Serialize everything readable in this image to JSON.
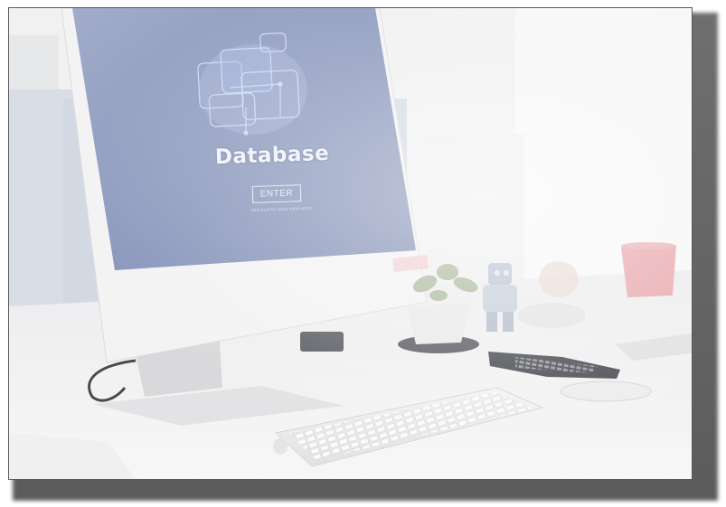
{
  "screen": {
    "title": "Database",
    "button_label": "ENTER",
    "tagline": "click here for more information"
  },
  "colors": {
    "screen": "#8e9bbd",
    "monitor_body": "#f3f3f4",
    "frame_border": "#5a5a5a",
    "shadow": "#666666",
    "cup": "#e7a7ac",
    "plant": "#a9b89a"
  },
  "objects": [
    "monitor",
    "keyboard",
    "mouse",
    "calculator",
    "potted-plant",
    "pink-cup",
    "robot-figurine",
    "cables"
  ]
}
